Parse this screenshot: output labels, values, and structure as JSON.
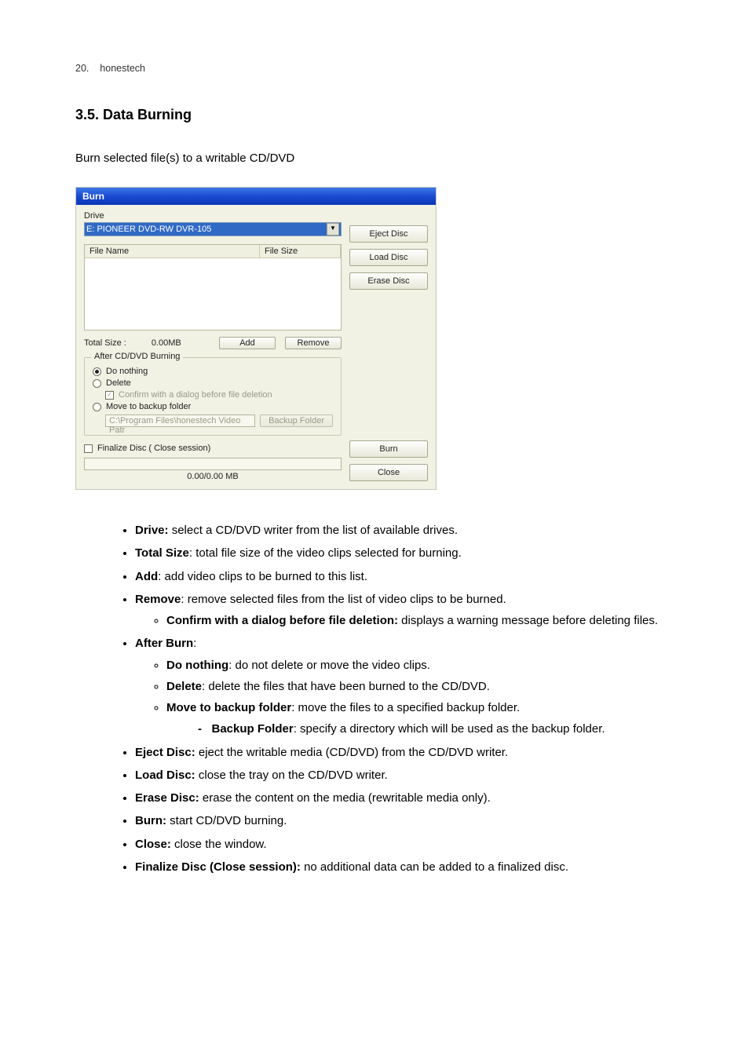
{
  "header": {
    "page_num": "20.",
    "brand": "honestech"
  },
  "section": {
    "title": "3.5. Data Burning",
    "intro": "Burn selected file(s) to a writable CD/DVD"
  },
  "dialog": {
    "title": "Burn",
    "drive_label": "Drive",
    "drive_value": "E: PIONEER  DVD-RW  DVR-105",
    "col_file_name": "File Name",
    "col_file_size": "File Size",
    "total_size_label": "Total Size :",
    "total_size_value": "0.00MB",
    "btn_add": "Add",
    "btn_remove": "Remove",
    "after_group": "After CD/DVD Burning",
    "opt_do_nothing": "Do nothing",
    "opt_delete": "Delete",
    "chk_confirm": "Confirm with a dialog before file deletion",
    "opt_move": "Move to backup folder",
    "backup_path": "C:\\Program Files\\honestech Video Patr",
    "btn_backup_folder": "Backup Folder",
    "finalize": "Finalize Disc  ( Close session)",
    "progress": "0.00/0.00 MB",
    "btn_eject": "Eject Disc",
    "btn_load": "Load Disc",
    "btn_erase": "Erase Disc",
    "btn_burn": "Burn",
    "btn_close": "Close"
  },
  "bullets": {
    "drive_b": "Drive:",
    "drive_t": " select a CD/DVD writer from the list of available drives.",
    "total_b": "Total Size",
    "total_t": ": total file size of the video clips selected for burning.",
    "add_b": "Add",
    "add_t": ": add video clips to be burned to this list.",
    "remove_b": "Remove",
    "remove_t": ": remove selected files from the list of video clips to be burned.",
    "confirm_b": "Confirm with a dialog before file deletion:",
    "confirm_t": " displays a warning message before deleting files.",
    "after_b": "After Burn",
    "after_t": ":",
    "donothing_b": "Do nothing",
    "donothing_t": ": do not delete or move the video clips.",
    "delete_b": "Delete",
    "delete_t": ": delete the files that have been burned to the CD/DVD.",
    "move_b": "Move to backup folder",
    "move_t": ": move the files to a specified backup folder.",
    "backup_b": "Backup Folder",
    "backup_t": ": specify a directory which will be used as the backup folder.",
    "eject_b": "Eject Disc:",
    "eject_t": " eject the writable media (CD/DVD) from the CD/DVD writer.",
    "load_b": "Load Disc:",
    "load_t": " close the tray on the CD/DVD writer.",
    "erase_b": "Erase Disc:",
    "erase_t": " erase the content on the media (rewritable media only).",
    "burn_b": "Burn:",
    "burn_t": " start CD/DVD burning.",
    "close_b": "Close:",
    "close_t": " close the window.",
    "finalize_b": "Finalize Disc (Close session):",
    "finalize_t": " no additional data can be added to a finalized disc."
  }
}
